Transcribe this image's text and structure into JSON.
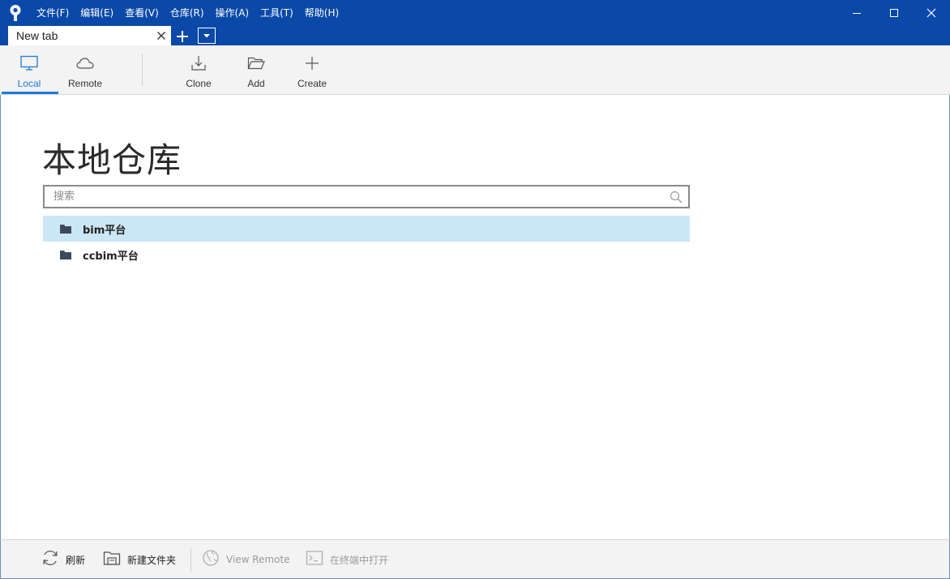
{
  "menu": {
    "items": [
      "文件(F)",
      "编辑(E)",
      "查看(V)",
      "仓库(R)",
      "操作(A)",
      "工具(T)",
      "帮助(H)"
    ]
  },
  "tabs": {
    "items": [
      {
        "label": "New tab"
      }
    ]
  },
  "toolbar": {
    "local_label": "Local",
    "remote_label": "Remote",
    "clone_label": "Clone",
    "add_label": "Add",
    "create_label": "Create"
  },
  "main": {
    "title": "本地仓库",
    "search": {
      "placeholder": "搜索",
      "value": ""
    },
    "repos": [
      {
        "name": "bim平台",
        "selected": true
      },
      {
        "name": "ccbim平台",
        "selected": false
      }
    ]
  },
  "bottom": {
    "refresh_label": "刷新",
    "new_folder_label": "新建文件夹",
    "view_remote_label": "View Remote",
    "open_terminal_label": "在终端中打开"
  },
  "colors": {
    "titlebar": "#0a49a8",
    "accent": "#1f7ad6",
    "selection": "#cbe6f5",
    "folder_icon": "#3d4a5c"
  },
  "icons": {
    "app": "sourcetree-logo-icon",
    "local": "monitor-icon",
    "remote": "cloud-icon",
    "clone": "download-icon",
    "add": "folder-open-icon",
    "create": "plus-icon",
    "search": "search-icon",
    "repo": "folder-icon",
    "refresh": "refresh-icon",
    "new_folder": "new-folder-icon",
    "view_remote": "globe-icon",
    "terminal": "terminal-icon"
  }
}
